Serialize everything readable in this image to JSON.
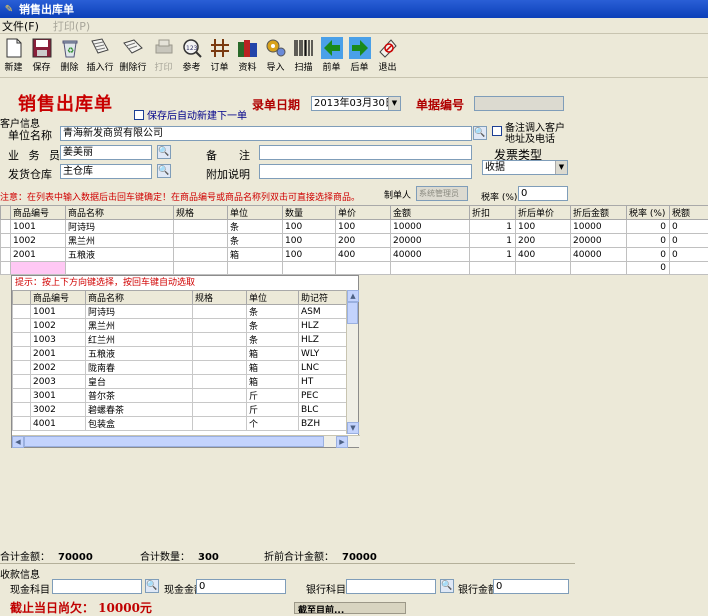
{
  "window": {
    "title": "销售出库单"
  },
  "menu": {
    "file": "文件(F)",
    "print": "打印(P)"
  },
  "toolbar": {
    "new": "新建",
    "save": "保存",
    "delete": "删除",
    "insert_row": "插入行",
    "delete_row": "删除行",
    "print": "打印",
    "reference": "参考",
    "order": "订单",
    "data": "资料",
    "import": "导入",
    "scan": "扫描",
    "prev": "前单",
    "next": "后单",
    "exit": "退出"
  },
  "header": {
    "title": "销售出库单",
    "auto_new_label": "保存后自动新建下一单",
    "date_label": "录单日期",
    "date_value": "2013年03月30日",
    "doc_no_label": "单据编号",
    "doc_no_value": ""
  },
  "customer": {
    "group_label": "客户信息",
    "unit_label": "单位名称",
    "unit_value": "青海新发商贸有限公司",
    "remember_label_1": "备注调入客户",
    "remember_label_2": "地址及电话",
    "salesman_label": "业 务 员",
    "salesman_value": "姜美丽",
    "remark_label": "备　　注",
    "remark_value": "",
    "warehouse_label": "发货仓库",
    "warehouse_value": "主仓库",
    "extra_label": "附加说明",
    "extra_value": "",
    "invoice_label": "发票类型",
    "invoice_value": "收据",
    "maker_label": "制单人",
    "maker_value": "系统管理员",
    "tax_label": "税率 (%)",
    "tax_value": "0"
  },
  "hint": "注意：在列表中输入数据后击回车键确定！在商品编号或商品名称列双击可直接选择商品。",
  "grid": {
    "columns": [
      "商品编号",
      "商品名称",
      "规格",
      "单位",
      "数量",
      "单价",
      "金额",
      "折扣",
      "折后单价",
      "折后金额",
      "税率 (%)",
      "税额"
    ],
    "rows": [
      [
        "1001",
        "阿诗玛",
        "",
        "条",
        "100",
        "100",
        "10000",
        "1",
        "100",
        "10000",
        "0",
        "0"
      ],
      [
        "1002",
        "黑兰州",
        "",
        "条",
        "100",
        "200",
        "20000",
        "1",
        "200",
        "20000",
        "0",
        "0"
      ],
      [
        "2001",
        "五粮液",
        "",
        "箱",
        "100",
        "400",
        "40000",
        "1",
        "400",
        "40000",
        "0",
        "0"
      ],
      [
        "",
        "",
        "",
        "",
        "",
        "",
        "",
        "",
        "",
        "",
        "0",
        ""
      ]
    ]
  },
  "popup": {
    "tip": "提示：按上下方向键选择，按回车键自动选取",
    "columns": [
      "商品编号",
      "商品名称",
      "规格",
      "单位",
      "助记符"
    ],
    "rows": [
      [
        "1001",
        "阿诗玛",
        "",
        "条",
        "ASM"
      ],
      [
        "1002",
        "黑兰州",
        "",
        "条",
        "HLZ"
      ],
      [
        "1003",
        "红兰州",
        "",
        "条",
        "HLZ"
      ],
      [
        "2001",
        "五粮液",
        "",
        "箱",
        "WLY"
      ],
      [
        "2002",
        "陇南春",
        "",
        "箱",
        "LNC"
      ],
      [
        "2003",
        "皇台",
        "",
        "箱",
        "HT"
      ],
      [
        "3001",
        "普尔茶",
        "",
        "斤",
        "PEC"
      ],
      [
        "3002",
        "碧螺春茶",
        "",
        "斤",
        "BLC"
      ],
      [
        "4001",
        "包装盒",
        "",
        "个",
        "BZH"
      ]
    ]
  },
  "totals": {
    "amount_label": "合计金额：",
    "amount_value": "70000",
    "qty_label": "合计数量：",
    "qty_value": "300",
    "disc_label": "折前合计金额：",
    "disc_value": "70000"
  },
  "receipt": {
    "group_label": "收款信息",
    "cash_subject_label": "现金科目",
    "cash_subject_value": "",
    "cash_amount_label": "现金金额",
    "cash_amount_value": "0",
    "bank_subject_label": "银行科目",
    "bank_subject_value": "",
    "bank_amount_label": "银行金额",
    "bank_amount_value": "0",
    "owe_text": "截止当日尚欠：  10000元",
    "bottom_bar_text": "截至目前..."
  }
}
